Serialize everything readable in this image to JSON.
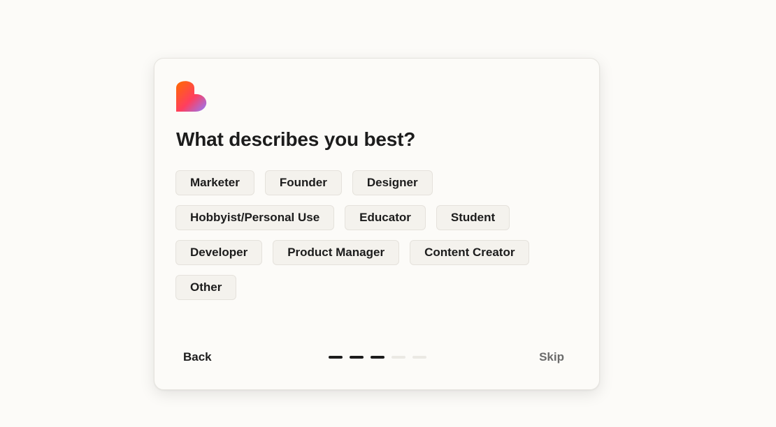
{
  "brand": {
    "logo_icon": "heart-logo-icon",
    "gradient_colors": [
      "#ff6a00",
      "#ff3e5e",
      "#8f7bff"
    ]
  },
  "onboarding": {
    "title": "What describes you best?",
    "options": [
      [
        "Marketer",
        "Founder",
        "Designer"
      ],
      [
        "Hobbyist/Personal Use",
        "Educator",
        "Student"
      ],
      [
        "Developer",
        "Product Manager",
        "Content Creator"
      ],
      [
        "Other"
      ]
    ],
    "progress": {
      "total_steps": 5,
      "completed_steps": 3
    }
  },
  "footer": {
    "back_label": "Back",
    "skip_label": "Skip"
  },
  "colors": {
    "background": "#fcfbf8",
    "chip_background": "#f4f2ed",
    "text": "#1c1c1c",
    "muted_text": "#6b6b6b"
  }
}
